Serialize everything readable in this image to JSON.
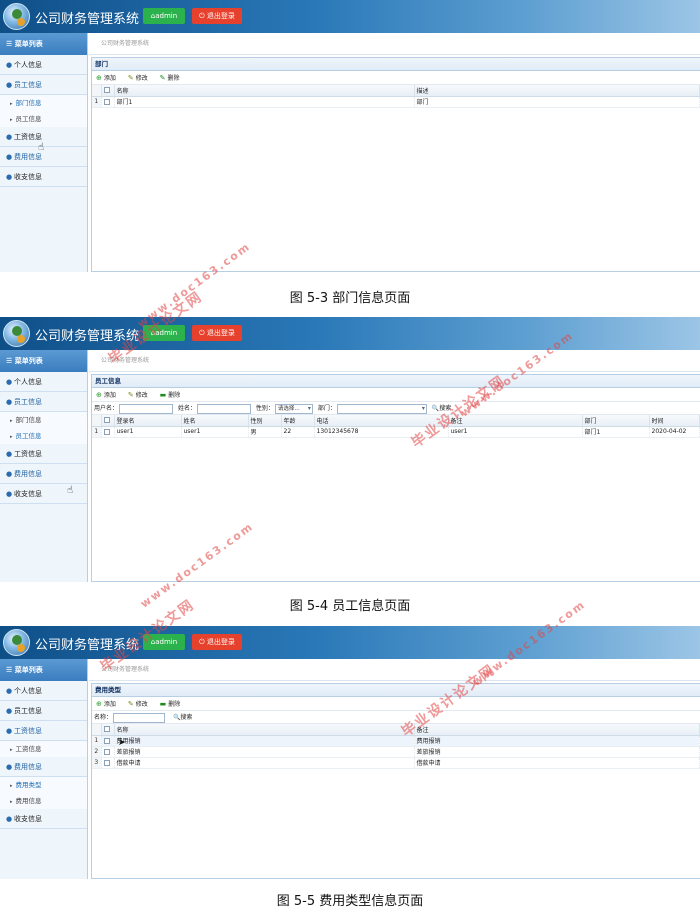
{
  "app": {
    "title": "公司财务管理系统",
    "user_button": "admin",
    "logout_button": "退出登录",
    "breadcrumb": "公司财务管理系统",
    "colors": {
      "header_start": "#0f4f88",
      "user_button": "#2bb24c",
      "logout_button": "#e5412d"
    }
  },
  "sidebar": {
    "header": "菜单列表",
    "items": {
      "personal": "个人信息",
      "employee": "员工信息",
      "dept_info": "部门信息",
      "emp_info": "员工信息",
      "salary": "工资信息",
      "salary_sub": "工资信息",
      "expense": "费用信息",
      "expense_type": "费用类型",
      "expense_info": "费用信息",
      "income": "收支信息"
    }
  },
  "toolbar": {
    "add": "添加",
    "edit": "修改",
    "delete": "删除",
    "search": "搜索"
  },
  "screen1": {
    "panel_title": "部门",
    "columns": [
      "名称",
      "描述"
    ],
    "rows": [
      {
        "n": "1",
        "name": "部门1",
        "desc": "部门"
      }
    ],
    "caption": "图 5-3 部门信息页面"
  },
  "screen2": {
    "panel_title": "员工信息",
    "filters": {
      "username": "用户名：",
      "name": "姓名：",
      "gender": "性别：",
      "gender_select": "请选择...",
      "dept": "部门："
    },
    "columns": [
      "登录名",
      "姓名",
      "性别",
      "年龄",
      "电话",
      "备注",
      "部门",
      "时间"
    ],
    "rows": [
      {
        "n": "1",
        "login": "user1",
        "name": "user1",
        "gender": "男",
        "age": "22",
        "phone": "13012345678",
        "note": "user1",
        "dept": "部门1",
        "time": "2020-04-02"
      }
    ],
    "caption": "图 5-4 员工信息页面"
  },
  "screen3": {
    "panel_title": "费用类型",
    "filters": {
      "name": "名称："
    },
    "columns": [
      "名称",
      "备注"
    ],
    "rows": [
      {
        "n": "1",
        "name": "费用报销",
        "note": "费用报销"
      },
      {
        "n": "2",
        "name": "差旅报销",
        "note": "差旅报销"
      },
      {
        "n": "3",
        "name": "借款申请",
        "note": "借款申请"
      }
    ],
    "caption": "图 5-5 费用类型信息页面"
  },
  "watermark": {
    "text": "毕业设计论文网",
    "url": "www.doc163.com"
  }
}
